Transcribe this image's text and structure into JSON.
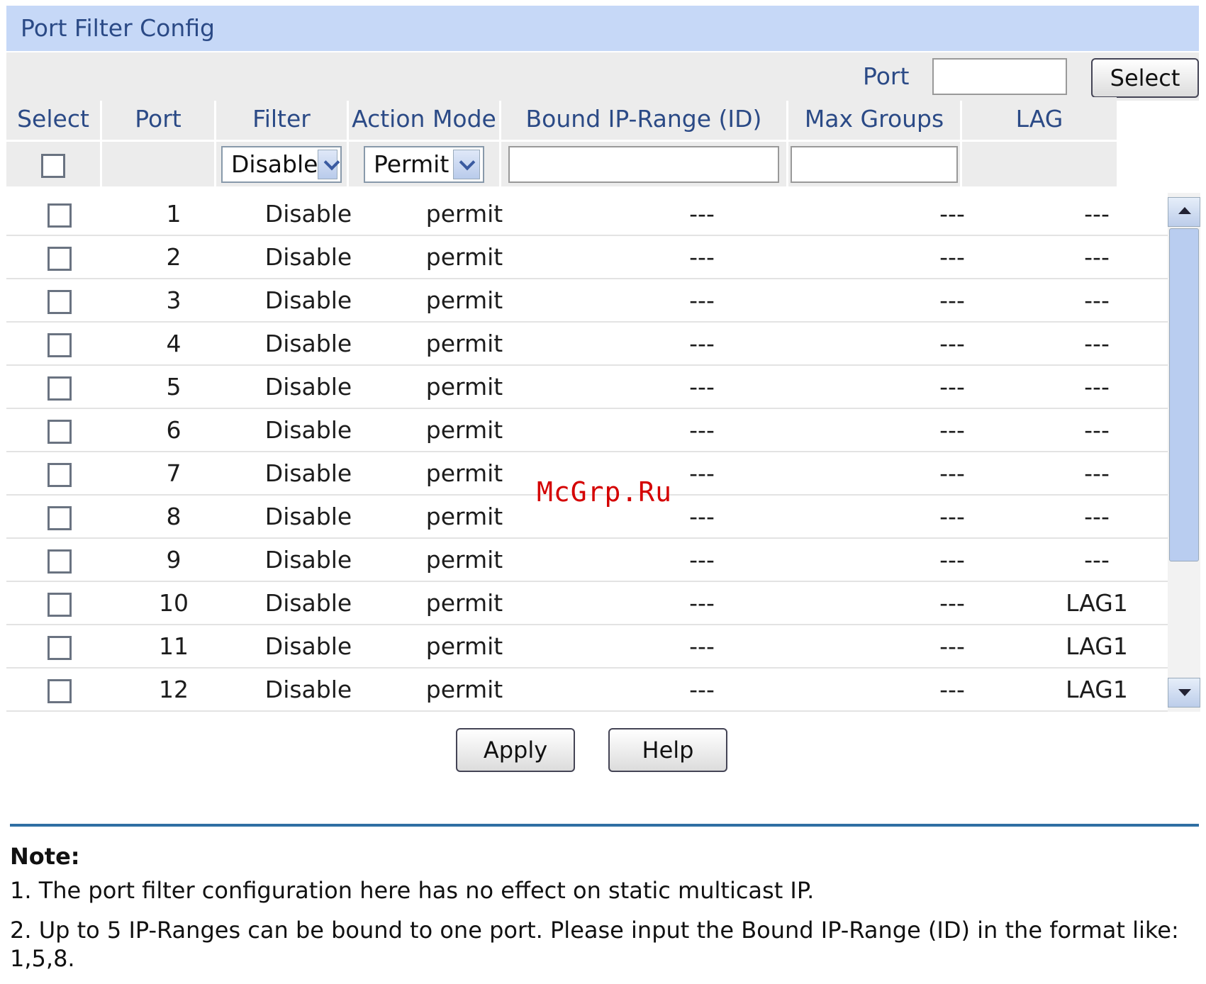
{
  "panel": {
    "title": "Port Filter Config"
  },
  "filter_bar": {
    "port_label": "Port",
    "port_value": "",
    "select_button": "Select"
  },
  "columns": [
    "Select",
    "Port",
    "Filter",
    "Action Mode",
    "Bound IP-Range (ID)",
    "Max Groups",
    "LAG"
  ],
  "controls": {
    "filter_value": "Disable",
    "action_value": "Permit",
    "bound_value": "",
    "max_value": ""
  },
  "rows": [
    {
      "port": "1",
      "filter": "Disable",
      "action": "permit",
      "bound": "---",
      "max": "---",
      "lag": "---"
    },
    {
      "port": "2",
      "filter": "Disable",
      "action": "permit",
      "bound": "---",
      "max": "---",
      "lag": "---"
    },
    {
      "port": "3",
      "filter": "Disable",
      "action": "permit",
      "bound": "---",
      "max": "---",
      "lag": "---"
    },
    {
      "port": "4",
      "filter": "Disable",
      "action": "permit",
      "bound": "---",
      "max": "---",
      "lag": "---"
    },
    {
      "port": "5",
      "filter": "Disable",
      "action": "permit",
      "bound": "---",
      "max": "---",
      "lag": "---"
    },
    {
      "port": "6",
      "filter": "Disable",
      "action": "permit",
      "bound": "---",
      "max": "---",
      "lag": "---"
    },
    {
      "port": "7",
      "filter": "Disable",
      "action": "permit",
      "bound": "---",
      "max": "---",
      "lag": "---"
    },
    {
      "port": "8",
      "filter": "Disable",
      "action": "permit",
      "bound": "---",
      "max": "---",
      "lag": "---"
    },
    {
      "port": "9",
      "filter": "Disable",
      "action": "permit",
      "bound": "---",
      "max": "---",
      "lag": "---"
    },
    {
      "port": "10",
      "filter": "Disable",
      "action": "permit",
      "bound": "---",
      "max": "---",
      "lag": "LAG1"
    },
    {
      "port": "11",
      "filter": "Disable",
      "action": "permit",
      "bound": "---",
      "max": "---",
      "lag": "LAG1"
    },
    {
      "port": "12",
      "filter": "Disable",
      "action": "permit",
      "bound": "---",
      "max": "---",
      "lag": "LAG1"
    }
  ],
  "buttons": {
    "apply": "Apply",
    "help": "Help"
  },
  "note": {
    "title": "Note:",
    "lines": [
      "1. The port filter configuration here has no effect on static multicast IP.",
      "2. Up to 5 IP-Ranges can be bound to one port. Please input the Bound IP-Range (ID) in the format like: 1,5,8."
    ]
  },
  "watermark": "McGrp.Ru",
  "colors": {
    "title_bg": "#c6d8f7",
    "title_text": "#2b4a86",
    "divider": "#2f6fa3",
    "watermark": "#d40000"
  }
}
